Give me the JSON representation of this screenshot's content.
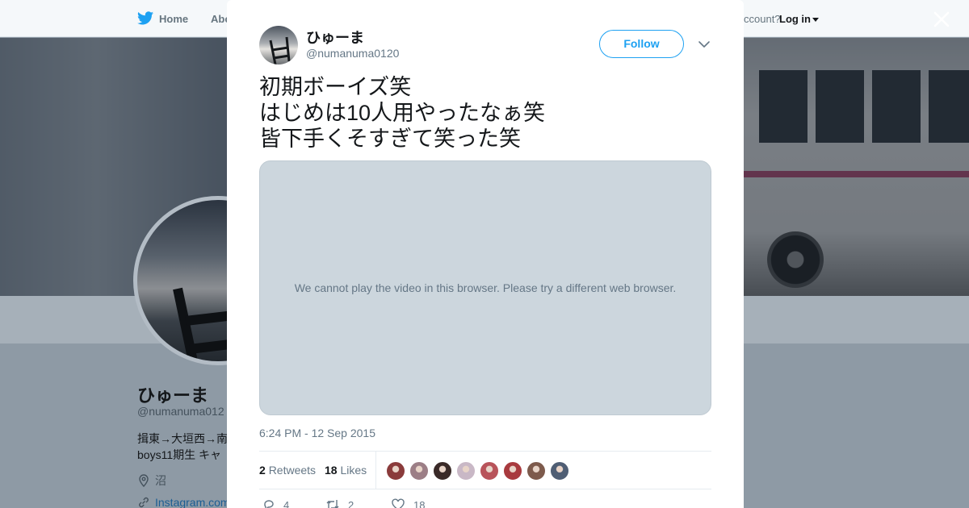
{
  "topbar": {
    "home_label": "Home",
    "about_label": "Abo",
    "account_prompt": "ccount?",
    "login_label": "Log in"
  },
  "profile": {
    "name": "ひゅーま",
    "handle": "@numanuma012",
    "bio_line1": "揖東→大垣西→南",
    "bio_line2": "boys11期生 キャ",
    "location": "沼",
    "link": "Instagram.com"
  },
  "tweet": {
    "author_name": "ひゅーま",
    "author_handle": "@numanuma0120",
    "follow_label": "Follow",
    "text_lines": [
      "初期ボーイズ笑",
      "はじめは10人用やったなぁ笑",
      "皆下手くそすぎて笑った笑"
    ],
    "video_message": "We cannot play the video in this browser. Please try a different web browser.",
    "timestamp": "6:24 PM - 12 Sep 2015",
    "retweets_count": "2",
    "retweets_label": "Retweets",
    "likes_count": "18",
    "likes_label": "Likes",
    "reply_count": "4",
    "retweet_action_count": "2",
    "like_action_count": "18"
  },
  "colors": {
    "accent": "#1da1f2",
    "text_primary": "#14171a",
    "text_secondary": "#657786",
    "video_bg": "#ccd6dd"
  },
  "likers": [
    {
      "name": "liker-avatar",
      "color": "#8a3b3b"
    },
    {
      "name": "liker-avatar",
      "color": "#9c7e86"
    },
    {
      "name": "liker-avatar",
      "color": "#3a2a28"
    },
    {
      "name": "liker-avatar",
      "color": "#c9b8c6"
    },
    {
      "name": "liker-avatar",
      "color": "#b8535a"
    },
    {
      "name": "liker-avatar",
      "color": "#a83a3e"
    },
    {
      "name": "liker-avatar",
      "color": "#7d5a4c"
    },
    {
      "name": "liker-avatar",
      "color": "#4f5e74"
    }
  ]
}
